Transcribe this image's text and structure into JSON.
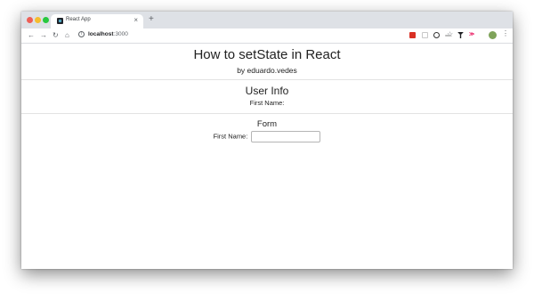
{
  "browser": {
    "tab_title": "React App",
    "tab_close": "×",
    "new_tab": "+",
    "url_host": "localhost",
    "url_port": ":3000",
    "icons": {
      "back": "back-arrow-icon",
      "forward": "forward-arrow-icon",
      "reload": "reload-icon",
      "home": "home-icon",
      "info": "info-icon",
      "bookmark": "star-icon",
      "menu": "kebab-menu-icon"
    }
  },
  "page": {
    "title": "How to setState in React",
    "byline": "by eduardo.vedes",
    "user_info": {
      "heading": "User Info",
      "first_name_label": "First Name:",
      "first_name_value": ""
    },
    "form": {
      "heading": "Form",
      "first_name_label": "First Name:",
      "first_name_input_value": ""
    }
  }
}
